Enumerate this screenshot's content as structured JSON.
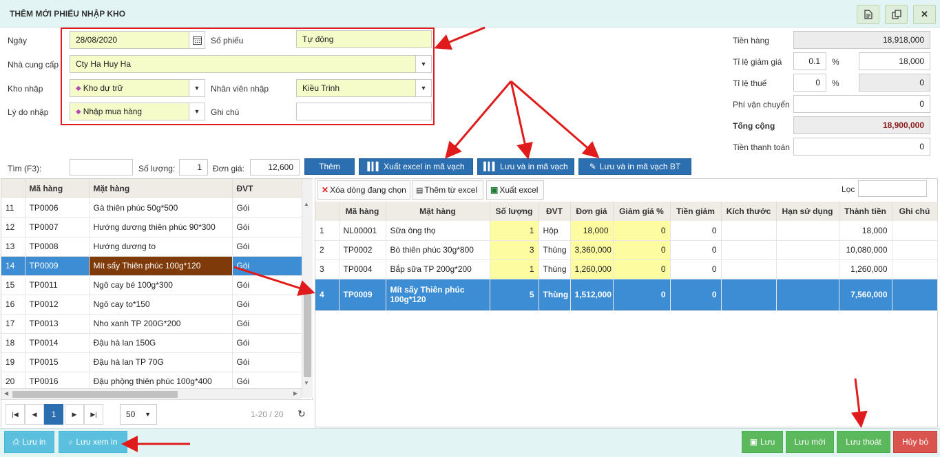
{
  "window": {
    "title": "THÊM MỚI PHIẾU NHẬP KHO",
    "icons": [
      "document-icon",
      "copy-icon",
      "close-icon"
    ],
    "close_glyph": "✕"
  },
  "form": {
    "date_label": "Ngày",
    "date_value": "28/08/2020",
    "voucher_label": "Số phiếu",
    "voucher_value": "Tự động",
    "supplier_label": "Nhà cung cấp",
    "supplier_value": "Cty Ha Huy Ha",
    "warehouse_label": "Kho nhập",
    "warehouse_value": "Kho dự trữ",
    "staff_label": "Nhân viên nhập",
    "staff_value": "Kiều Trinh",
    "reason_label": "Lý do nhập",
    "reason_value": "Nhập mua hàng",
    "note_label": "Ghi chú",
    "note_value": ""
  },
  "totals": {
    "goods_label": "Tiền hàng",
    "goods_value": "18,918,000",
    "discount_label": "Tỉ lệ giảm giá",
    "discount_rate": "0.1",
    "discount_pct": "%",
    "discount_value": "18,000",
    "tax_label": "Tỉ lệ thuế",
    "tax_rate": "0",
    "tax_pct": "%",
    "tax_value": "0",
    "ship_label": "Phí vận chuyển",
    "ship_value": "0",
    "total_label": "Tổng cộng",
    "total_value": "18,900,000",
    "paid_label": "Tiền thanh toán",
    "paid_value": "0"
  },
  "search": {
    "find_label": "Tìm (F3):",
    "find_value": "",
    "qty_label": "Số lượng:",
    "qty_value": "1",
    "price_label": "Đơn giá:",
    "price_value": "12,600"
  },
  "actions": {
    "add": "Thêm",
    "export_barcode": "Xuất excel in mã vạch",
    "save_print_barcode": "Lưu và in mã vạch",
    "save_print_barcode_bt": "Lưu và in mã vạch BT"
  },
  "left_table": {
    "headers": [
      "",
      "Mã hàng",
      "Mặt hàng",
      "ĐVT"
    ],
    "rows": [
      [
        "11",
        "TP0006",
        "Gà thiên phúc 50g*500",
        "Gói"
      ],
      [
        "12",
        "TP0007",
        "Hướng dương thiên phúc 90*300",
        "Gói"
      ],
      [
        "13",
        "TP0008",
        "Hướng dương to",
        "Gói"
      ],
      [
        "14",
        "TP0009",
        "Mít sấy Thiên phúc 100g*120",
        "Gói"
      ],
      [
        "15",
        "TP0011",
        "Ngô cay bé 100g*300",
        "Gói"
      ],
      [
        "16",
        "TP0012",
        "Ngô cay to*150",
        "Gói"
      ],
      [
        "17",
        "TP0013",
        "Nho xanh TP 200G*200",
        "Gói"
      ],
      [
        "18",
        "TP0014",
        "Đậu hà lan 150G",
        "Gói"
      ],
      [
        "19",
        "TP0015",
        "Đậu hà lan TP 70G",
        "Gói"
      ],
      [
        "20",
        "TP0016",
        "Đậu phộng thiên phúc 100g*400",
        "Gói"
      ]
    ],
    "selected_index": 3
  },
  "pager": {
    "current": "1",
    "page_size": "50",
    "info": "1-20 / 20"
  },
  "right_toolbar": {
    "delete_row": "Xóa dòng đang chọn",
    "import_excel": "Thêm từ excel",
    "export_excel": "Xuất excel",
    "filter_label": "Lọc",
    "filter_value": ""
  },
  "right_table": {
    "headers": [
      "",
      "Mã hàng",
      "Mặt hàng",
      "Số lượng",
      "ĐVT",
      "Đơn giá",
      "Giảm giá %",
      "Tiền giảm",
      "Kích thước",
      "Hạn sử dụng",
      "Thành tiền",
      "Ghi chú"
    ],
    "rows": [
      [
        "1",
        "NL00001",
        "Sữa ông thọ",
        "1",
        "Hộp",
        "18,000",
        "0",
        "0",
        "",
        "",
        "18,000",
        ""
      ],
      [
        "2",
        "TP0002",
        "Bò thiên phúc 30g*800",
        "3",
        "Thùng",
        "3,360,000",
        "0",
        "0",
        "",
        "",
        "10,080,000",
        ""
      ],
      [
        "3",
        "TP0004",
        "Bắp sữa TP 200g*200",
        "1",
        "Thùng",
        "1,260,000",
        "0",
        "0",
        "",
        "",
        "1,260,000",
        ""
      ],
      [
        "4",
        "TP0009",
        "Mít sấy Thiên phúc 100g*120",
        "5",
        "Thùng",
        "1,512,000",
        "0",
        "0",
        "",
        "",
        "7,560,000",
        ""
      ]
    ],
    "selected_index": 3
  },
  "footer": {
    "save_print": "Lưu in",
    "save_preview": "Lưu xem in",
    "save": "Lưu",
    "save_new": "Lưu mới",
    "save_exit": "Lưu thoát",
    "cancel": "Hủy bỏ"
  },
  "colors": {
    "accent_blue": "#2b6fb1",
    "highlight_red": "#e01b1b",
    "green": "#5cb85c",
    "danger": "#d9534f",
    "light_blue": "#5bc0de"
  }
}
